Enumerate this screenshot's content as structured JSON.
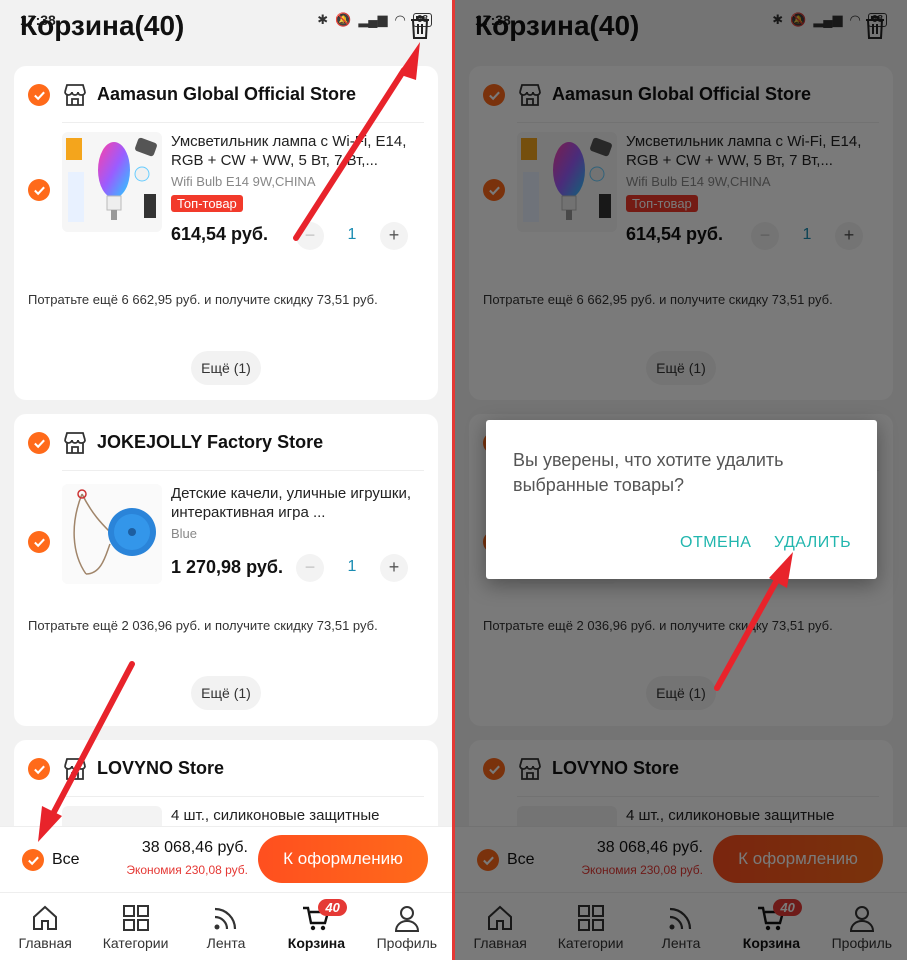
{
  "status": {
    "time": "17:38",
    "battery": "68"
  },
  "header": {
    "title": "Корзина(40)"
  },
  "stores": [
    {
      "name": "Aamasun Global Official Store",
      "item": {
        "title": "Умсветильник лампа с Wi-Fi, E14, RGB + CW + WW, 5 Вт, 7 Вт,...",
        "variant": "Wifi Bulb E14 9W,CHINA",
        "badge": "Топ-товар",
        "price": "614,54 руб.",
        "qty": "1"
      },
      "promo": "Потратьте ещё 6 662,95 руб. и получите скидку 73,51 руб.",
      "more": "Ещё (1)"
    },
    {
      "name": "JOKEJOLLY Factory Store",
      "item": {
        "title": "Детские качели, уличные игрушки, интерактивная игра ...",
        "variant": "Blue",
        "price": "1 270,98 руб.",
        "qty": "1"
      },
      "promo": "Потратьте ещё 2 036,96 руб. и получите скидку 73,51 руб.",
      "more": "Ещё (1)"
    },
    {
      "name": "LOVYNO Store",
      "item": {
        "title": "4 шт., силиконовые защитные"
      }
    }
  ],
  "bottom": {
    "all_label": "Все",
    "total": "38 068,46 руб.",
    "savings": "Экономия 230,08 руб.",
    "checkout": "К оформлению"
  },
  "tabs": [
    {
      "label": "Главная",
      "icon": "home-icon"
    },
    {
      "label": "Категории",
      "icon": "categories-icon"
    },
    {
      "label": "Лента",
      "icon": "feed-icon"
    },
    {
      "label": "Корзина",
      "icon": "cart-icon",
      "badge": "40",
      "active": true
    },
    {
      "label": "Профиль",
      "icon": "profile-icon"
    }
  ],
  "dialog": {
    "message": "Вы уверены, что хотите удалить выбранные товары?",
    "cancel": "ОТМЕНА",
    "delete": "УДАЛИТЬ"
  },
  "colors": {
    "accent": "#ff6a1a",
    "badge": "#e53935",
    "dialog_button": "#21b6ae",
    "annotation_arrow": "#e8232b"
  }
}
